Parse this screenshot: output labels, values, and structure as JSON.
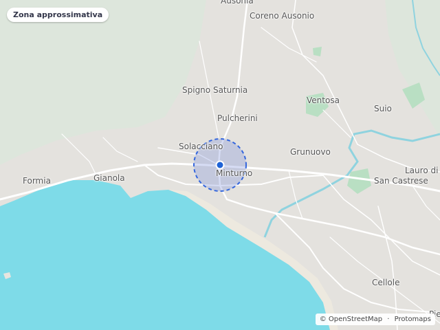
{
  "map": {
    "zone_label": "Zona approssimativa",
    "places": [
      {
        "name": "Ausonia",
        "slug": "ausonia"
      },
      {
        "name": "Coreno Ausonio",
        "slug": "coreno-ausonio"
      },
      {
        "name": "Spigno Saturnia",
        "slug": "spigno-saturnia"
      },
      {
        "name": "Pulcherini",
        "slug": "pulcherini"
      },
      {
        "name": "Ventosa",
        "slug": "ventosa"
      },
      {
        "name": "Suio",
        "slug": "suio"
      },
      {
        "name": "Solacciano",
        "slug": "solacciano"
      },
      {
        "name": "Grunuovo",
        "slug": "grunuovo"
      },
      {
        "name": "Minturno",
        "slug": "minturno"
      },
      {
        "name": "Formia",
        "slug": "formia"
      },
      {
        "name": "Gianola",
        "slug": "gianola"
      },
      {
        "name": "Lauro di S",
        "slug": "lauro-di-s"
      },
      {
        "name": "San Castrese",
        "slug": "san-castrese"
      },
      {
        "name": "Cellole",
        "slug": "cellole"
      },
      {
        "name": "Pie",
        "slug": "pie"
      }
    ],
    "attribution": {
      "copyright": "©",
      "osm": "OpenStreetMap",
      "separator": "·",
      "tiles": "Protomaps"
    },
    "colors": {
      "land": "#e4e2de",
      "sea": "#7edbe8",
      "river": "#8fd3df",
      "park": "#9fd6b0",
      "roads": "#ffffff",
      "zone_fill": "#8899dd",
      "zone_stroke": "#3366dd",
      "marker": "#1f63d6"
    }
  }
}
